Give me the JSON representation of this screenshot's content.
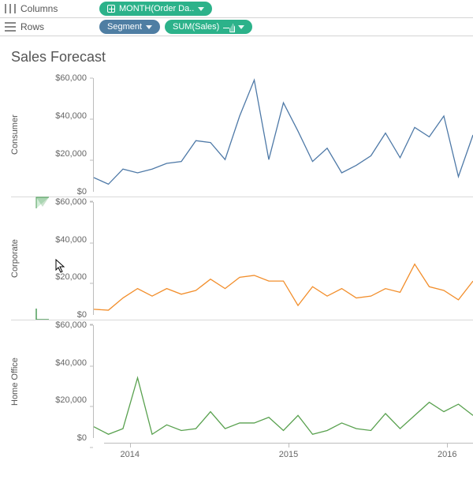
{
  "shelves": {
    "columns": {
      "label": "Columns",
      "pill_date": "MONTH(Order Da.."
    },
    "rows": {
      "label": "Rows",
      "pill_segment": "Segment",
      "pill_measure": "SUM(Sales)"
    }
  },
  "title": "Sales Forecast",
  "y_axis": {
    "max": 60000,
    "ticks": [
      0,
      20000,
      40000,
      60000
    ],
    "labels": [
      "$0",
      "$20,000",
      "$40,000",
      "$60,000"
    ]
  },
  "x_axis": {
    "labels": [
      "2014",
      "2015",
      "2016"
    ],
    "positions_pct": [
      7,
      50,
      93
    ]
  },
  "chart_data": {
    "type": "line",
    "title": "Sales Forecast",
    "xlabel": "MONTH(Order Date)",
    "ylabel": "SUM(Sales)",
    "ylim": [
      0,
      60000
    ],
    "x": [
      "2014-01",
      "2014-02",
      "2014-03",
      "2014-04",
      "2014-05",
      "2014-06",
      "2014-07",
      "2014-08",
      "2014-09",
      "2014-10",
      "2014-11",
      "2014-12",
      "2015-01",
      "2015-02",
      "2015-03",
      "2015-04",
      "2015-05",
      "2015-06",
      "2015-07",
      "2015-08",
      "2015-09",
      "2015-10",
      "2015-11",
      "2015-12",
      "2016-01",
      "2016-02",
      "2016-03"
    ],
    "series": [
      {
        "name": "Consumer",
        "color": "#4e79a7",
        "values": [
          7500,
          4000,
          12000,
          10000,
          12000,
          15000,
          16000,
          27000,
          26000,
          17000,
          40000,
          59000,
          17000,
          47000,
          32000,
          16000,
          23000,
          10000,
          14000,
          19000,
          31000,
          18000,
          34000,
          29000,
          40000,
          8000,
          30000
        ]
      },
      {
        "name": "Corporate",
        "color": "#f28e2b",
        "values": [
          3000,
          2500,
          9000,
          14000,
          10000,
          14000,
          11000,
          13000,
          19000,
          14000,
          20000,
          21000,
          18000,
          18000,
          5000,
          15000,
          10000,
          14000,
          9000,
          10000,
          14000,
          12000,
          27000,
          15000,
          13000,
          8000,
          18000
        ]
      },
      {
        "name": "Home Office",
        "color": "#59a14f",
        "values": [
          6000,
          2000,
          5000,
          32000,
          2000,
          7000,
          4000,
          5000,
          14000,
          5000,
          8000,
          8000,
          11000,
          4000,
          12000,
          2000,
          4000,
          8000,
          5000,
          4000,
          13000,
          5000,
          12000,
          19000,
          14000,
          18000,
          12000
        ]
      }
    ]
  }
}
